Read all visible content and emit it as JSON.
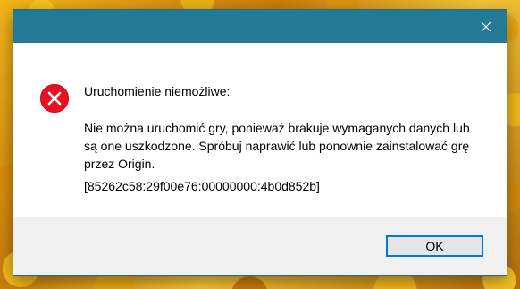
{
  "dialog": {
    "title": "",
    "heading": "Uruchomienie niemożliwe:",
    "message": "Nie można uruchomić gry, ponieważ brakuje wymaganych danych lub są one uszkodzone. Spróbuj naprawić lub ponownie zainstalować grę przez Origin.",
    "error_code": "[85262c58:29f00e76:00000000:4b0d852b]",
    "icon": "error-icon"
  },
  "buttons": {
    "ok_label": "OK",
    "close_icon": "close-icon"
  },
  "colors": {
    "titlebar": "#237a94",
    "error_icon": "#e81123",
    "footer": "#f0f0f0",
    "ok_border": "#0078d7"
  }
}
